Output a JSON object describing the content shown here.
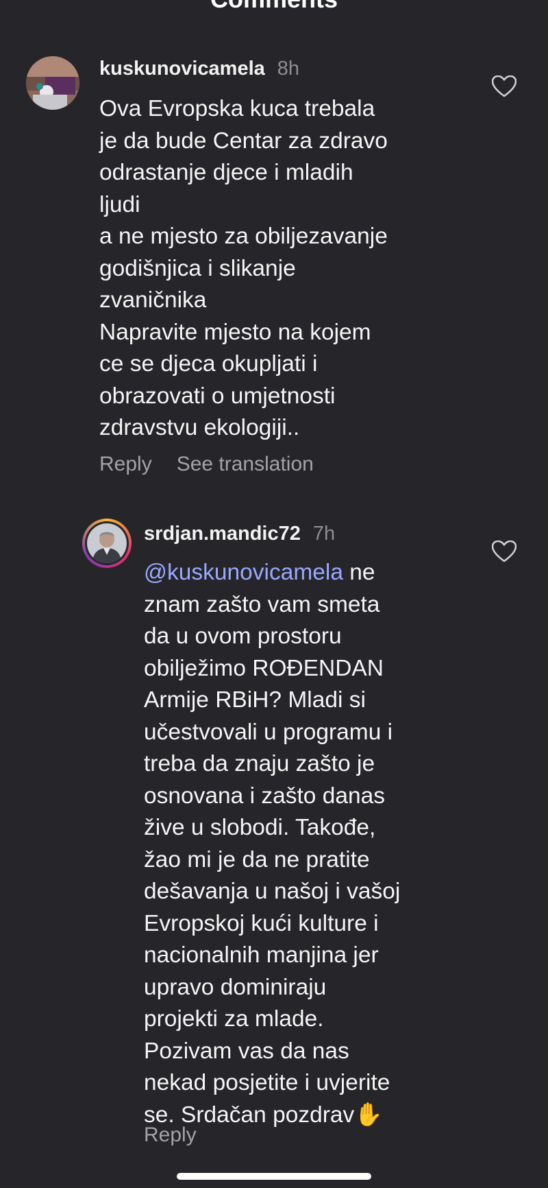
{
  "header": {
    "title": "Comments"
  },
  "comments": [
    {
      "username": "kuskunovicamela",
      "time": "8h",
      "text": "Ova Evropska kuca trebala\nje da bude Centar za zdravo\nodrastanje djece i mladih\nljudi\na ne mjesto za obiljezavanje\ngodišnjica i slikanje\nzvaničnika\nNapravite mjesto na kojem\nce se djeca okupljati i\nobrazovati o umjetnosti\nzdravstvu ekologiji..",
      "reply_label": "Reply",
      "translate_label": "See translation"
    },
    {
      "username": "srdjan.mandic72",
      "time": "7h",
      "mention": "@kuskunovicamela",
      "text": " ne\nznam zašto vam smeta\nda u ovom prostoru\nobilježimo ROĐENDAN\nArmije RBiH? Mladi si\nučestvovali u programu i\ntreba da znaju zašto je\nosnovana i zašto danas\nžive u slobodi. Takođe,\nžao mi je da ne pratite\ndešavanja u našoj i vašoj\nEvropskoj kući kulture i\nnacionalnih manjina jer\nupravo dominiraju\nprojekti za mlade.\nPozivam vas da nas\nnekad posjetite i uvjerite\nse. Srdačan pozdrav",
      "emoji": "✋",
      "reply_label": "Reply"
    }
  ],
  "icons": {
    "like": "heart-outline-icon"
  }
}
